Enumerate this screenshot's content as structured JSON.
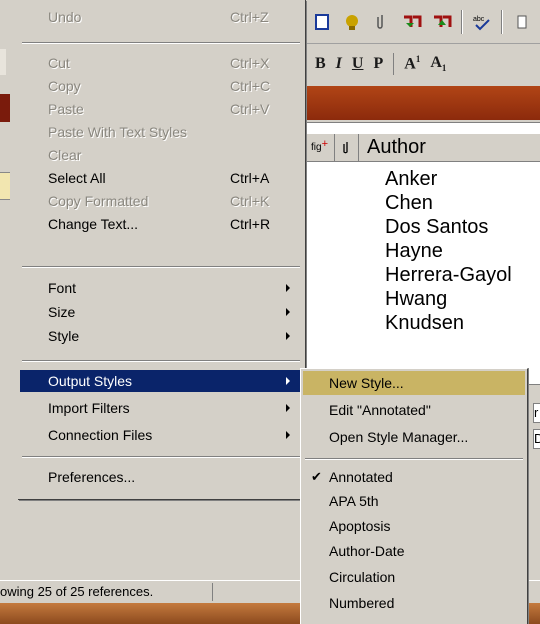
{
  "menu": {
    "undo": {
      "label": "Undo",
      "shortcut": "Ctrl+Z"
    },
    "cut": {
      "label": "Cut",
      "shortcut": "Ctrl+X"
    },
    "copy": {
      "label": "Copy",
      "shortcut": "Ctrl+C"
    },
    "paste": {
      "label": "Paste",
      "shortcut": "Ctrl+V"
    },
    "paste_styles": {
      "label": "Paste With Text Styles"
    },
    "clear": {
      "label": "Clear"
    },
    "select_all": {
      "label": "Select All",
      "shortcut": "Ctrl+A"
    },
    "copy_formatted": {
      "label": "Copy Formatted",
      "shortcut": "Ctrl+K"
    },
    "change_text": {
      "label": "Change Text...",
      "shortcut": "Ctrl+R"
    },
    "font": {
      "label": "Font"
    },
    "size": {
      "label": "Size"
    },
    "style": {
      "label": "Style"
    },
    "output_styles": {
      "label": "Output Styles"
    },
    "import_filters": {
      "label": "Import Filters"
    },
    "connection_files": {
      "label": "Connection Files"
    },
    "preferences": {
      "label": "Preferences..."
    }
  },
  "submenu": {
    "new_style": "New Style...",
    "edit_annotated": "Edit \"Annotated\"",
    "open_style_manager": "Open Style Manager...",
    "styles": [
      "Annotated",
      "APA 5th",
      "Apoptosis",
      "Author-Date",
      "Circulation",
      "Numbered"
    ],
    "checked_style": "Annotated",
    "highlight_color": "#c9b464"
  },
  "toolbar2": {
    "bold": "B",
    "italic": "I",
    "underline": "U",
    "plain": "P",
    "superscript": "A",
    "sup_mark": "1",
    "subscript": "A",
    "sub_mark": "1"
  },
  "references": {
    "header": {
      "fig": "fig",
      "author": "Author"
    },
    "authors": [
      "Anker",
      "Chen",
      "Dos Santos",
      "Hayne",
      "Herrera-Gayol",
      "Hwang",
      "Knudsen"
    ]
  },
  "lower_pane": {
    "box1": "r",
    "box2": "D"
  },
  "status": {
    "text": "owing 25 of 25 references."
  },
  "colors": {
    "menu_bg": "#d4d0c8",
    "selection": "#0a246a",
    "accent_red": "#9b3510"
  }
}
